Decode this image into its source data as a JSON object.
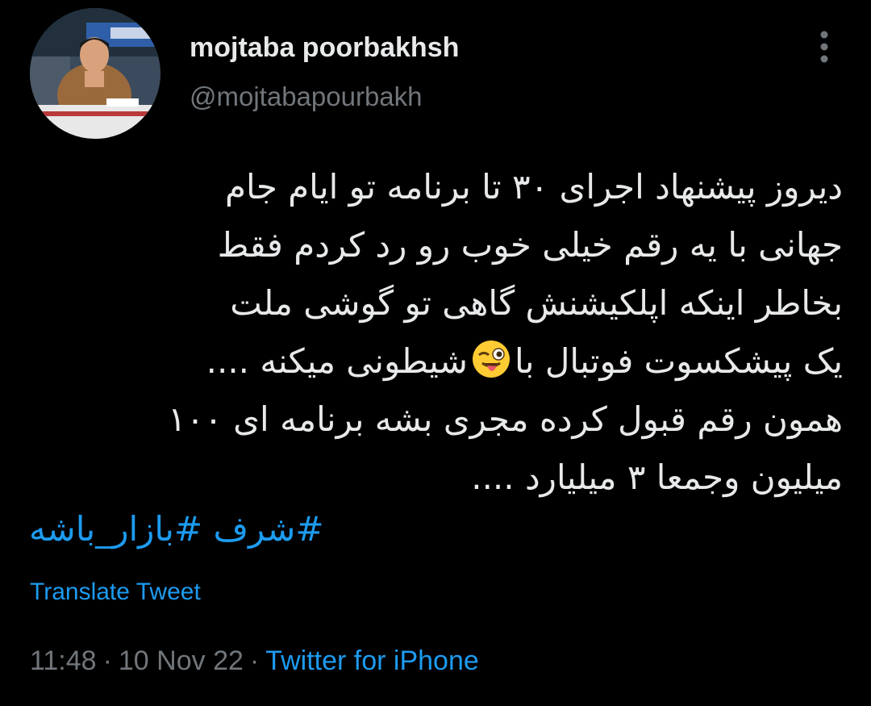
{
  "author": {
    "display_name": "mojtaba poorbakhsh",
    "handle": "@mojtabapourbakh"
  },
  "tweet": {
    "lines": [
      "دیروز پیشنهاد اجرای ۳۰ تا برنامه تو ایام جام",
      "جهانی با یه رقم خیلی خوب رو  رد کردم فقط",
      "بخاطر اینکه اپلکیشنش گاهی تو گوشی ملت",
      "یک پیشکسوت فوتبال با",
      "شیطونی میکنه ....",
      "همون رقم قبول کرده مجری بشه برنامه ای ۱۰۰",
      "میلیون وجمعا ۳ میلیارد ...."
    ],
    "emoji": "winking-face-with-tongue",
    "hashtags": [
      "#شرف",
      "#بازار_باشه"
    ]
  },
  "translate_label": "Translate Tweet",
  "meta": {
    "time": "11:48",
    "date": "10 Nov 22",
    "separator": "·",
    "source": "Twitter for iPhone"
  },
  "colors": {
    "background": "#000000",
    "text": "#e7e9ea",
    "secondary": "#71767b",
    "link": "#1d9bf0"
  }
}
